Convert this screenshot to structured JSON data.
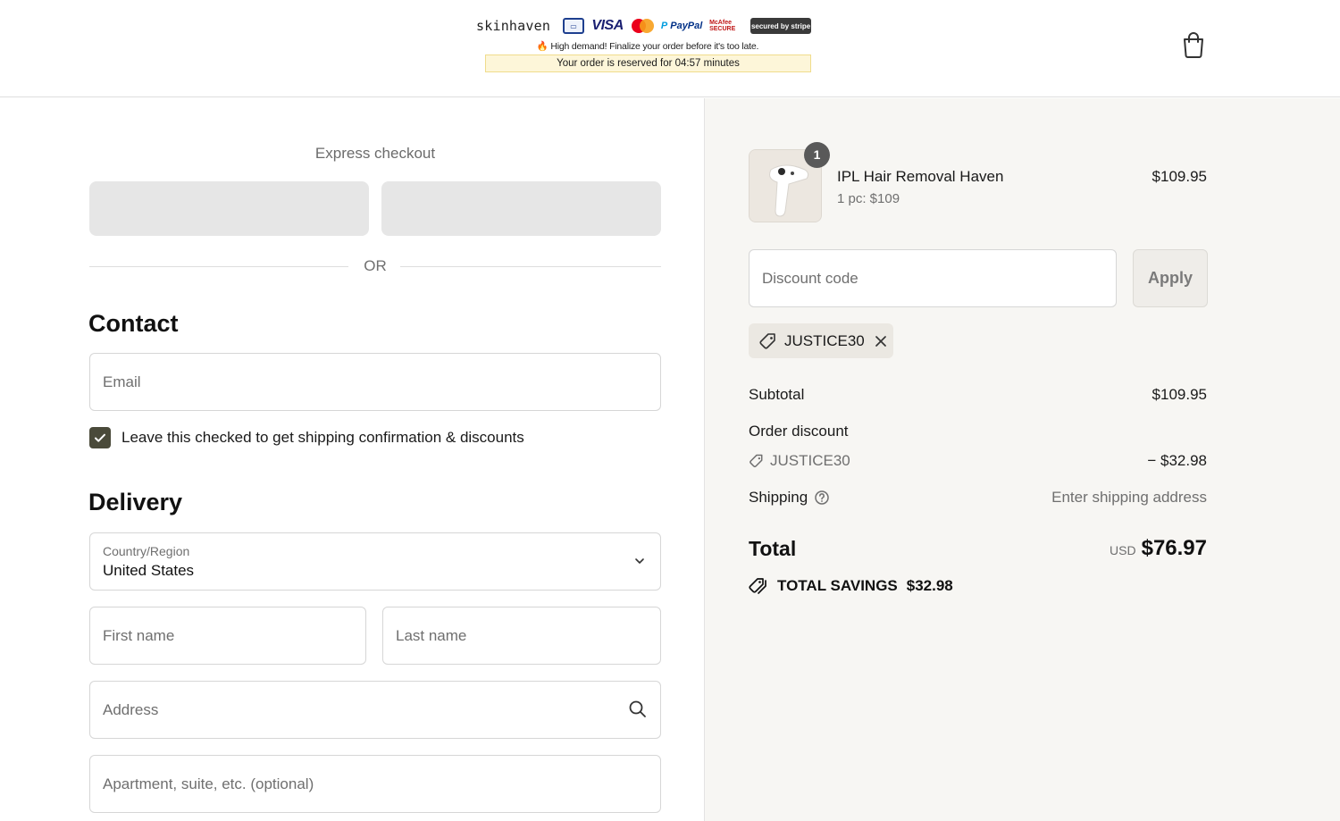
{
  "header": {
    "brand": "skinhaven",
    "badges": [
      "card-icon",
      "visa-logo",
      "mastercard-logo",
      "paypal-logo",
      "mcafee-secure-badge",
      "secured-by-stripe-badge"
    ],
    "badge_text": {
      "visa": "VISA",
      "paypal_p": "P",
      "paypal_word": "PayPal",
      "mcafee": "McAfee SECURE",
      "stripe": "secured by stripe"
    },
    "urgency": "High demand! Finalize your order before it's too late.",
    "reserve_prefix": "Your order is reserved for",
    "reserve_time": "04:57",
    "reserve_suffix": "minutes",
    "cart_icon": "shopping-bag-icon"
  },
  "left": {
    "express_title": "Express checkout",
    "or_text": "OR",
    "contact_title": "Contact",
    "email_placeholder": "Email",
    "checkbox_label": "Leave this checked to get shipping confirmation & discounts",
    "checkbox_checked": true,
    "delivery_title": "Delivery",
    "country_label": "Country/Region",
    "country_value": "United States",
    "first_name_placeholder": "First name",
    "last_name_placeholder": "Last name",
    "address_placeholder": "Address",
    "apartment_placeholder": "Apartment, suite, etc. (optional)"
  },
  "summary": {
    "product": {
      "name": "IPL Hair Removal Haven",
      "sub": "1 pc: $109",
      "price": "$109.95",
      "quantity": "1"
    },
    "discount_placeholder": "Discount code",
    "apply_label": "Apply",
    "applied_code": "JUSTICE30",
    "subtotal_label": "Subtotal",
    "subtotal_value": "$109.95",
    "order_discount_label": "Order discount",
    "discount_code": "JUSTICE30",
    "discount_value": "− $32.98",
    "shipping_label": "Shipping",
    "shipping_value": "Enter shipping address",
    "total_label": "Total",
    "currency": "USD",
    "total_value": "$76.97",
    "savings_label": "TOTAL SAVINGS",
    "savings_value": "$32.98"
  },
  "colors": {
    "checkbox": "#4a4a3a",
    "summary_bg": "#f7f6f3",
    "reserve_bg": "#fdf6d9"
  }
}
